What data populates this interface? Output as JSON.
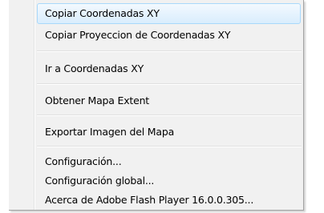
{
  "context_menu": {
    "items": [
      {
        "label": "Copiar Coordenadas XY"
      },
      {
        "label": "Copiar Proyeccion de Coordenadas XY"
      },
      {
        "label": "Ir a Coordenadas XY"
      },
      {
        "label": "Obtener Mapa Extent"
      },
      {
        "label": "Exportar Imagen del Mapa"
      },
      {
        "label": "Configuración..."
      },
      {
        "label": "Configuración global..."
      },
      {
        "label": "Acerca de Adobe Flash Player 16.0.0.305..."
      }
    ],
    "colors": {
      "background": "#f1f1f1",
      "highlight_border": "#a8d8fb",
      "highlight_fill": "#d9edfd",
      "separator": "#e0e0e0"
    }
  }
}
